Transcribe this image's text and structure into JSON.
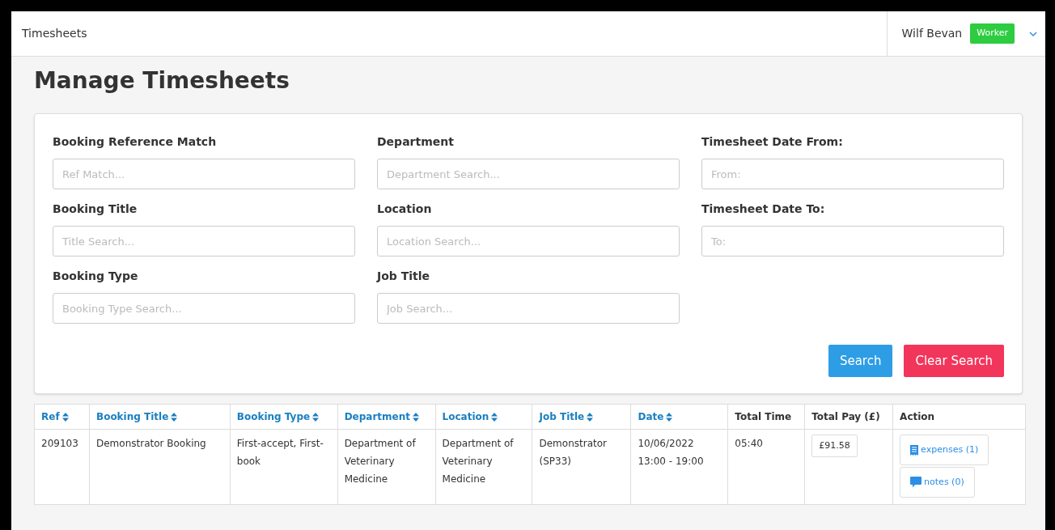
{
  "header": {
    "title": "Timesheets",
    "user": "Wilf Bevan",
    "role": "Worker"
  },
  "page_title": "Manage Timesheets",
  "filters": [
    {
      "label": "Booking Reference Match",
      "placeholder": "Ref Match..."
    },
    {
      "label": "Department",
      "placeholder": "Department Search..."
    },
    {
      "label": "Timesheet Date From:",
      "placeholder": "From:"
    },
    {
      "label": "Booking Title",
      "placeholder": "Title Search..."
    },
    {
      "label": "Location",
      "placeholder": "Location Search..."
    },
    {
      "label": "Timesheet Date To:",
      "placeholder": "To:"
    },
    {
      "label": "Booking Type",
      "placeholder": "Booking Type Search..."
    },
    {
      "label": "Job Title",
      "placeholder": "Job Search..."
    }
  ],
  "buttons": [
    {
      "label": "Search",
      "kind": "primary"
    },
    {
      "label": "Clear Search",
      "kind": "danger"
    }
  ],
  "table": {
    "columns": [
      {
        "label": "Ref",
        "sortable": true
      },
      {
        "label": "Booking Title",
        "sortable": true
      },
      {
        "label": "Booking Type",
        "sortable": true
      },
      {
        "label": "Department",
        "sortable": true
      },
      {
        "label": "Location",
        "sortable": true
      },
      {
        "label": "Job Title",
        "sortable": true
      },
      {
        "label": "Date",
        "sortable": true
      },
      {
        "label": "Total Time",
        "sortable": false
      },
      {
        "label": "Total Pay (£)",
        "sortable": false
      },
      {
        "label": "Action",
        "sortable": false
      }
    ],
    "rows": [
      {
        "ref": "209103",
        "booking_title": "Demonstrator Booking",
        "booking_type": "First-accept, First-book",
        "department": "Department of Veterinary Medicine",
        "location": "Department of Veterinary Medicine",
        "job_title": "Demonstrator (SP33)",
        "date": [
          "10/06/2022",
          "13:00 - 19:00"
        ],
        "total_time": "05:40",
        "total_pay": "£91.58",
        "actions": [
          {
            "kind": "expenses",
            "label": "expenses (1)"
          },
          {
            "kind": "notes",
            "label": "notes (0)"
          }
        ]
      }
    ]
  }
}
